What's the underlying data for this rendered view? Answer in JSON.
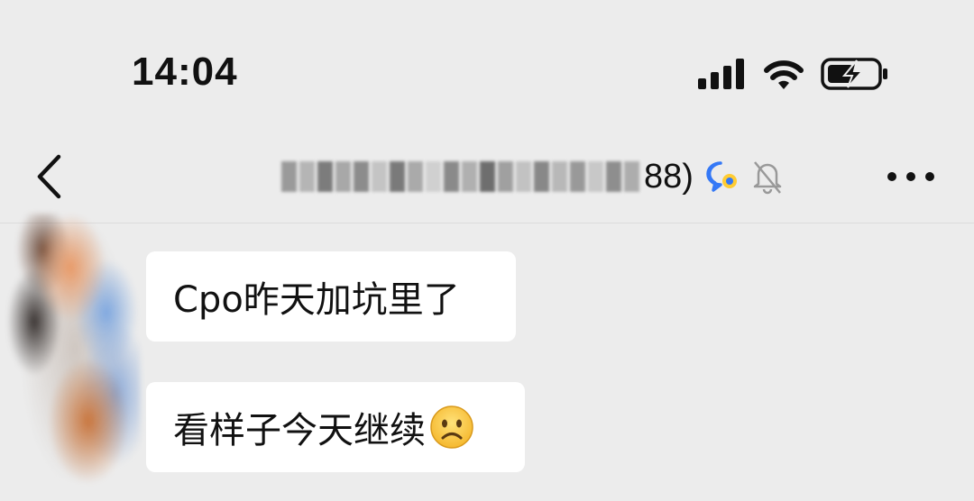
{
  "status_bar": {
    "time": "14:04",
    "icons": [
      "signal-icon",
      "wifi-icon",
      "battery-charging-icon"
    ]
  },
  "nav": {
    "back_icon": "chevron-left-icon",
    "title_visible": "88)",
    "title_icons": [
      "group-chat-icon",
      "mute-bell-icon"
    ],
    "more_icon": "more-dots-icon"
  },
  "messages": [
    {
      "text": "Cpo昨天加坑里了",
      "emoji": ""
    },
    {
      "text": "看样子今天继续",
      "emoji": "sad-face-emoji"
    }
  ],
  "colors": {
    "background": "#ececec",
    "bubble": "#ffffff",
    "text": "#111111",
    "accent_blue": "#3478f6"
  }
}
